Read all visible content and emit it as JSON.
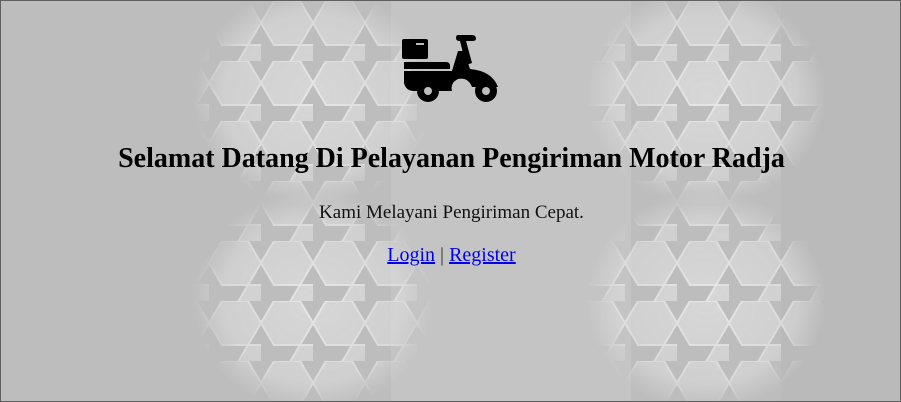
{
  "page": {
    "heading": "Selamat Datang Di Pelayanan Pengiriman Motor Radja",
    "tagline": "Kami Melayani Pengiriman Cepat.",
    "logo_icon": "delivery-scooter-icon"
  },
  "nav": {
    "login_label": "Login",
    "separator": "|",
    "register_label": "Register"
  },
  "colors": {
    "background": "#bdbdbd",
    "hex_pattern": "#e2e2e2",
    "heading": "#000000",
    "link": "#0000ee"
  }
}
